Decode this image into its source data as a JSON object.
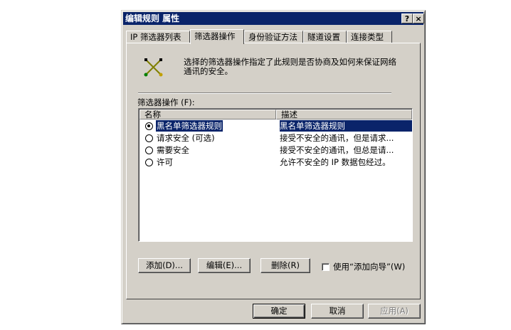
{
  "window": {
    "title": "编辑规则 属性",
    "help_button": "?",
    "close_button": "×"
  },
  "tabs": [
    {
      "label": "IP 筛选器列表",
      "active": false
    },
    {
      "label": "筛选器操作",
      "active": true
    },
    {
      "label": "身份验证方法",
      "active": false
    },
    {
      "label": "隧道设置",
      "active": false
    },
    {
      "label": "连接类型",
      "active": false
    }
  ],
  "panel": {
    "icon": "filter-action-icon",
    "description": "选择的筛选器操作指定了此规则是否协商及如何来保证网络通讯的安全。",
    "list_label": "筛选器操作 (F):"
  },
  "list": {
    "columns": [
      "名称",
      "描述"
    ],
    "rows": [
      {
        "name": "黑名单筛选器规则",
        "description": "黑名单筛选器规则",
        "selected": true
      },
      {
        "name": "请求安全 (可选)",
        "description": "接受不安全的通讯，但是请求...",
        "selected": false
      },
      {
        "name": "需要安全",
        "description": "接受不安全的通讯，但总是请...",
        "selected": false
      },
      {
        "name": "许可",
        "description": "允许不安全的 IP 数据包经过。",
        "selected": false
      }
    ]
  },
  "actions": {
    "add_label": "添加(D)...",
    "edit_label": "编辑(E)...",
    "delete_label": "删除(R)",
    "wizard_label": "使用“添加向导”(W)",
    "wizard_checked": false
  },
  "footer": {
    "ok_label": "确定",
    "cancel_label": "取消",
    "apply_label": "应用(A)",
    "apply_enabled": false
  },
  "colors": {
    "titlebar": "#0a246a",
    "face": "#d4d0c8",
    "selection": "#0a246a"
  }
}
